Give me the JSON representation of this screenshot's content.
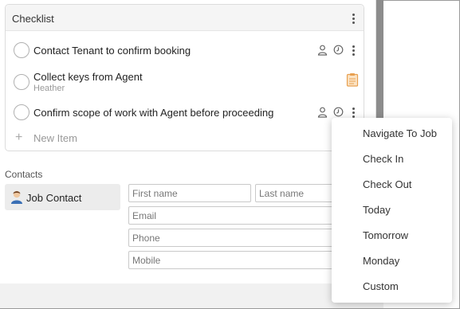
{
  "checklist": {
    "title": "Checklist",
    "items": [
      {
        "title": "Contact Tenant to confirm booking",
        "subtitle": ""
      },
      {
        "title": "Collect keys from Agent",
        "subtitle": "Heather"
      },
      {
        "title": "Confirm scope of work with Agent before proceeding",
        "subtitle": ""
      }
    ],
    "new_item_label": "New Item",
    "icons": {
      "assignee": "person-icon",
      "due": "clock-icon",
      "more": "kebab-menu-icon",
      "note": "clipboard-icon"
    }
  },
  "contacts": {
    "section_label": "Contacts",
    "tab_label": "Job Contact",
    "fields": {
      "first_name_placeholder": "First name",
      "last_name_placeholder": "Last name",
      "email_placeholder": "Email",
      "phone_placeholder": "Phone",
      "mobile_placeholder": "Mobile"
    }
  },
  "menu": {
    "items": [
      "Navigate To Job",
      "Check In",
      "Check Out",
      "Today",
      "Tomorrow",
      "Monday",
      "Custom"
    ]
  },
  "colors": {
    "scrollbar": "#8c8c8c",
    "header_bg": "#f5f5f5",
    "clipboard": "#e8a050"
  }
}
